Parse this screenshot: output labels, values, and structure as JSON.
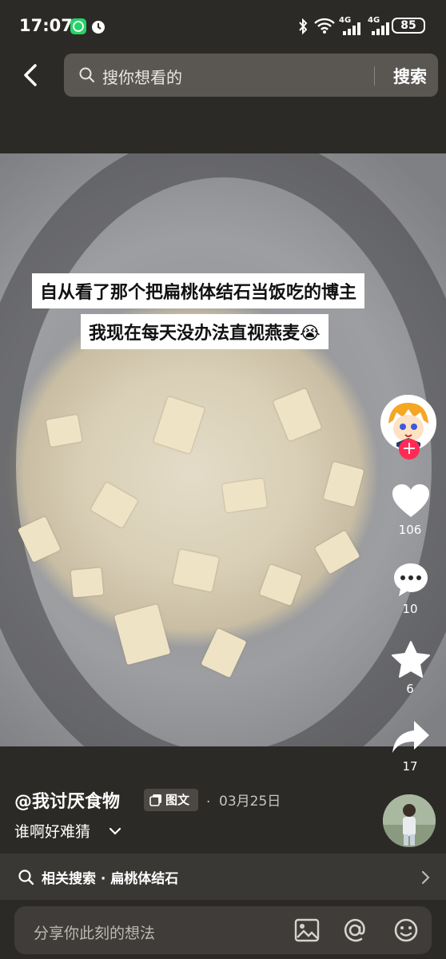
{
  "status_bar": {
    "time": "17:07",
    "battery": "85",
    "net1": "4G",
    "net2": "4G"
  },
  "search": {
    "placeholder": "搜你想看的",
    "button": "搜索"
  },
  "post": {
    "caption_line1": "自从看了那个把扁桃体结石当饭吃的博主",
    "caption_line2": "我现在每天没办法直视燕麦😭",
    "likes": "106",
    "comments": "10",
    "favorites": "6",
    "shares": "17",
    "author": "@我讨厌食物",
    "type_badge": "图文",
    "date": "03月25日",
    "description": "谁啊好难猜"
  },
  "related": {
    "prefix": "相关搜索",
    "term": "扁桃体结石"
  },
  "comment": {
    "placeholder": "分享你此刻的想法"
  },
  "colors": {
    "accent": "#fe2c55",
    "background": "#2c2a27"
  },
  "icons": [
    "back-icon",
    "search-icon",
    "heart-icon",
    "comment-icon",
    "star-icon",
    "share-icon",
    "chevron-down-icon",
    "chevron-right-icon",
    "image-icon",
    "at-icon",
    "emoji-icon"
  ]
}
